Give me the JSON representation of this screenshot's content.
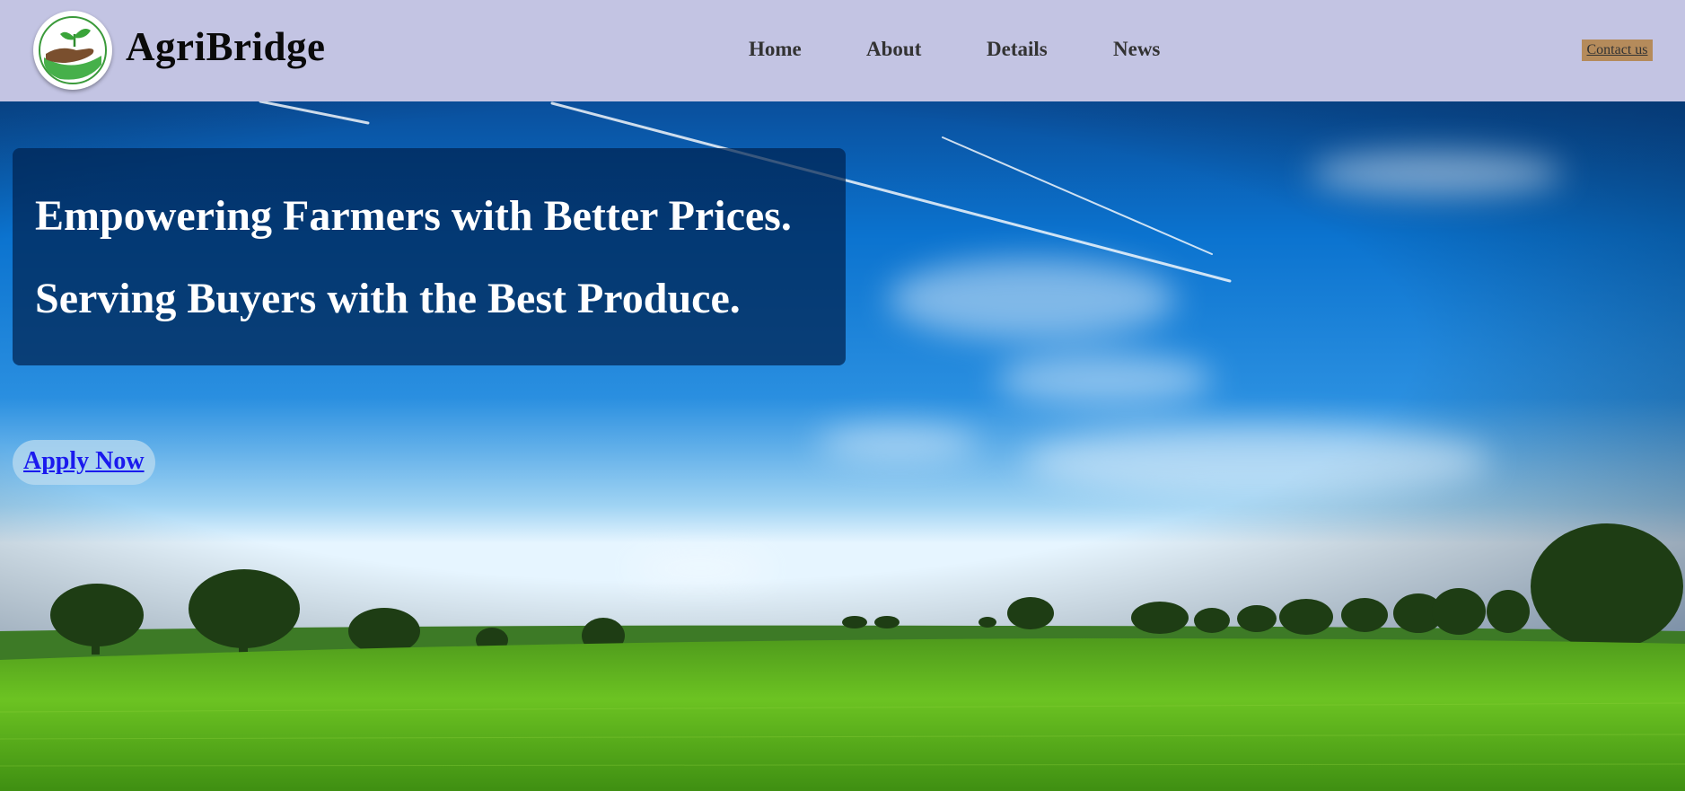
{
  "header": {
    "brand": "AgriBridge",
    "logo_icon": "hand-holding-sprout-icon",
    "nav": [
      "Home",
      "About",
      "Details",
      "News"
    ],
    "contact_label": "Contact us"
  },
  "hero": {
    "headline_line1": "Empowering Farmers with Better Prices.",
    "headline_line2": "Serving Buyers with the Best Produce.",
    "apply_label": "Apply Now"
  },
  "colors": {
    "header_bg": "#c3c4e3",
    "contact_bg": "#b58b5b",
    "headline_box": "#002350",
    "apply_link": "#1a1aee"
  }
}
